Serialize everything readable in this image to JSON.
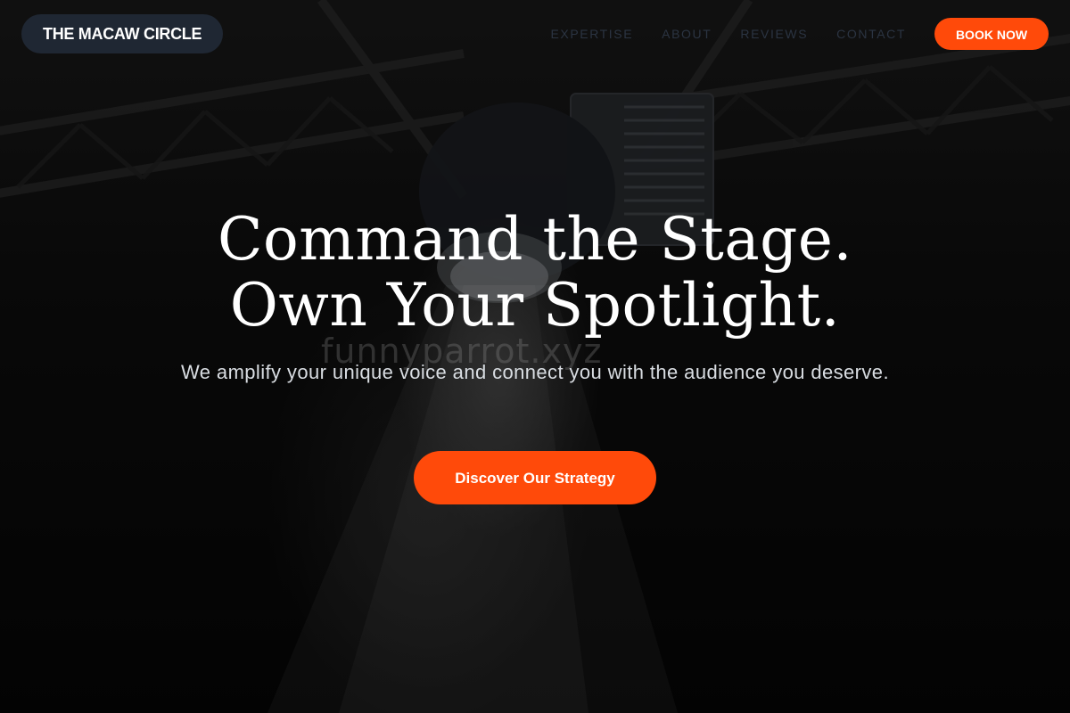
{
  "header": {
    "brand": "THE MACAW CIRCLE",
    "nav": [
      "EXPERTISE",
      "ABOUT",
      "REVIEWS",
      "CONTACT"
    ],
    "book_label": "BOOK NOW"
  },
  "hero": {
    "title_line1": "Command the Stage.",
    "title_line2": "Own Your Spotlight.",
    "subtitle": "We amplify your unique voice and connect you with the audience you deserve.",
    "cta_label": "Discover Our Strategy",
    "watermark": "funnyparrot.xyz"
  },
  "colors": {
    "accent": "#ff4a0a",
    "brand_pill": "#1f2733",
    "nav_text": "#2b3442",
    "background": "#050505"
  },
  "icons": [
    "stage-spotlight-image"
  ]
}
